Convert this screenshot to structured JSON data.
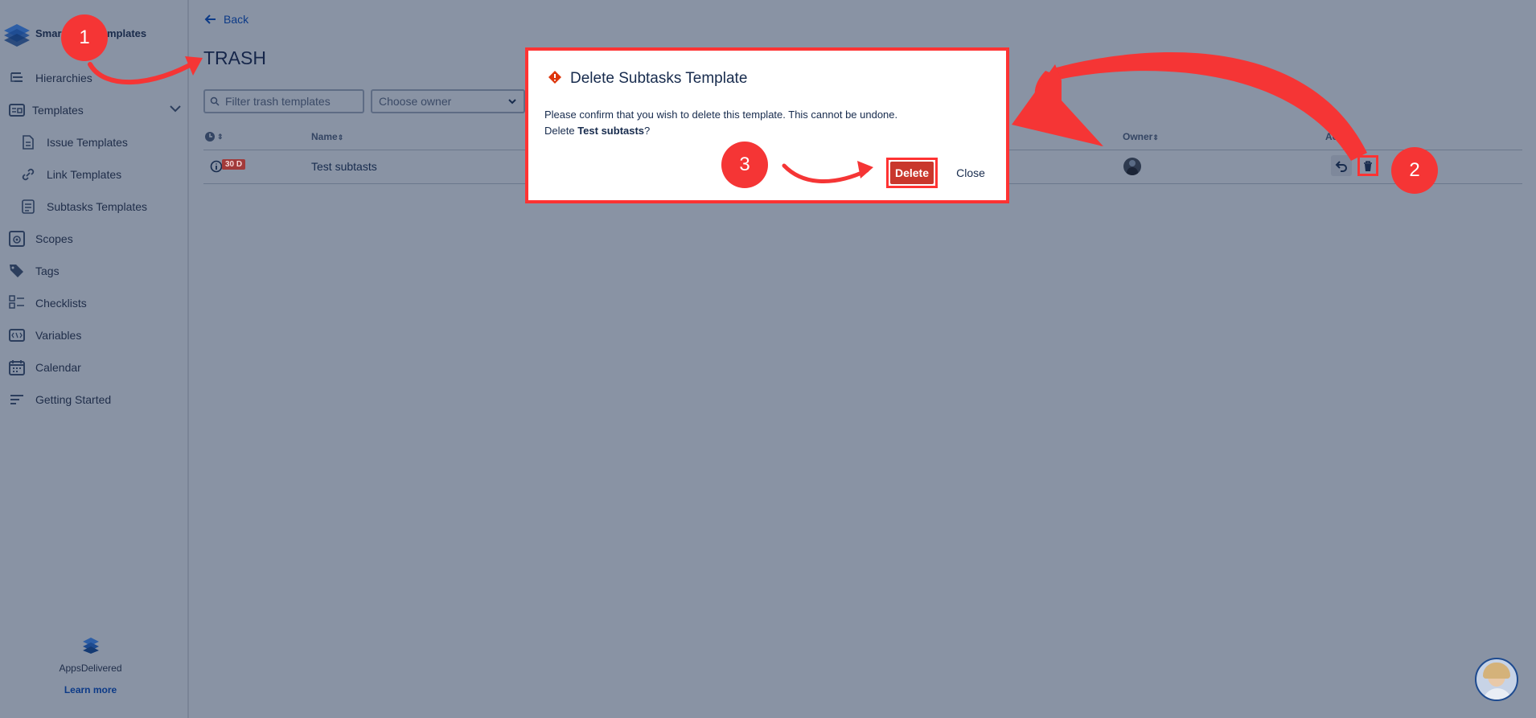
{
  "app": {
    "name_left": "Smar",
    "name_right": "mplates"
  },
  "sidebar": {
    "items": [
      {
        "label": "Hierarchies",
        "icon": "hierarchy-icon"
      },
      {
        "label": "Templates",
        "icon": "templates-icon"
      },
      {
        "label": "Issue Templates",
        "icon": "issue-template-icon"
      },
      {
        "label": "Link Templates",
        "icon": "link-icon"
      },
      {
        "label": "Subtasks Templates",
        "icon": "subtasks-icon"
      },
      {
        "label": "Scopes",
        "icon": "scopes-icon"
      },
      {
        "label": "Tags",
        "icon": "tag-icon"
      },
      {
        "label": "Checklists",
        "icon": "checklist-icon"
      },
      {
        "label": "Variables",
        "icon": "variables-icon"
      },
      {
        "label": "Calendar",
        "icon": "calendar-icon"
      },
      {
        "label": "Getting Started",
        "icon": "getting-started-icon"
      }
    ],
    "footer": {
      "brand": "AppsDelivered",
      "link": "Learn more"
    }
  },
  "header": {
    "back": "Back",
    "title": "TRASH"
  },
  "filters": {
    "search_placeholder": "Filter trash templates",
    "owner_placeholder": "Choose owner"
  },
  "table": {
    "headers": {
      "name": "Name",
      "owner": "Owner",
      "actions": "Ac"
    },
    "rows": [
      {
        "days": "30 D",
        "name": "Test subtasts"
      }
    ]
  },
  "modal": {
    "title": "Delete Subtasks Template",
    "line1": "Please confirm that you wish to delete this template. This cannot be undone.",
    "line2_prefix": "Delete ",
    "line2_bold": "Test subtasts",
    "line2_suffix": "?",
    "delete_label": "Delete",
    "close_label": "Close"
  },
  "annotations": {
    "step1": "1",
    "step2": "2",
    "step3": "3"
  },
  "colors": {
    "accent": "#0052cc",
    "danger": "#de350b",
    "annotation": "#f53535",
    "overlay": "#8993a4"
  }
}
